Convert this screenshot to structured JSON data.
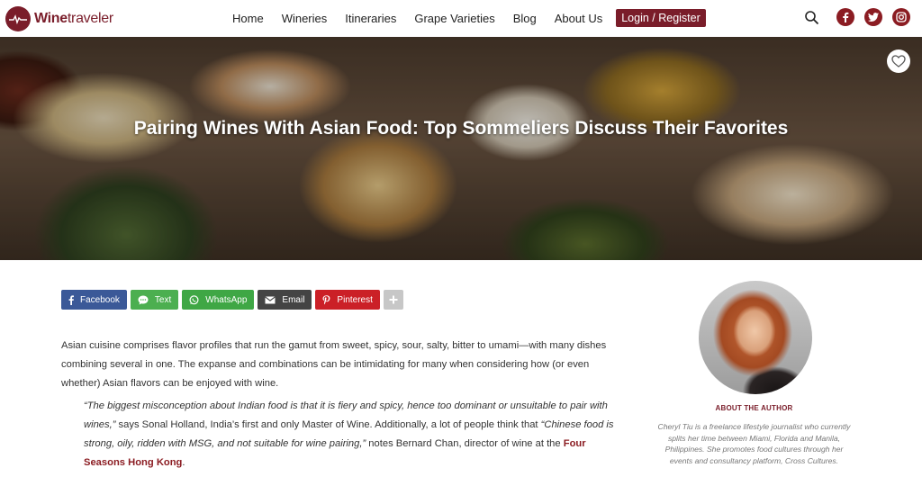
{
  "header": {
    "logo_text_bold": "Wine",
    "logo_text_light": "traveler",
    "nav": [
      "Home",
      "Wineries",
      "Itineraries",
      "Grape Varieties",
      "Blog",
      "About Us"
    ],
    "login_label": "Login / Register",
    "icons": [
      "search-icon",
      "facebook-icon",
      "twitter-icon",
      "instagram-icon"
    ],
    "brand_color": "#7a1d2a"
  },
  "hero": {
    "title": "Pairing Wines With Asian Food: Top Sommeliers Discuss Their Favorites",
    "favorite_icon": "heart-icon"
  },
  "share": {
    "buttons": [
      {
        "label": "Facebook",
        "color": "#3b5998",
        "icon": "facebook-icon"
      },
      {
        "label": "Text",
        "color": "#4caf50",
        "icon": "text-bubble-icon"
      },
      {
        "label": "WhatsApp",
        "color": "#3fa745",
        "icon": "whatsapp-icon"
      },
      {
        "label": "Email",
        "color": "#444444",
        "icon": "email-icon"
      },
      {
        "label": "Pinterest",
        "color": "#cb2027",
        "icon": "pinterest-icon"
      }
    ],
    "more_icon": "plus-icon"
  },
  "article": {
    "intro": "Asian cuisine comprises flavor profiles that run the gamut from sweet, spicy, sour, salty, bitter to umami—with many dishes combining several in one. The expanse and combinations can be intimidating for many when considering how (or even whether) Asian flavors can be enjoyed with wine.",
    "quote_part1": "“The biggest misconception about Indian food is that it is fiery and spicy, hence too dominant or unsuitable to pair with wines,”",
    "quote_part2": " says Sonal Holland, India’s first and only Master of Wine. Additionally, a lot of people think that ",
    "quote_part3": "“Chinese food is strong, oily, ridden with MSG, and not suitable for wine pairing,”",
    "quote_part4": " notes Bernard Chan, director of wine at the ",
    "quote_link": "Four Seasons Hong Kong",
    "quote_end": "."
  },
  "author": {
    "heading": "ABOUT THE AUTHOR",
    "bio": "Cheryl Tiu is a freelance lifestyle journalist who currently splits her time between Miami, Florida and Manila, Philippines. She promotes food cultures through her events and consultancy platform, Cross Cultures."
  }
}
